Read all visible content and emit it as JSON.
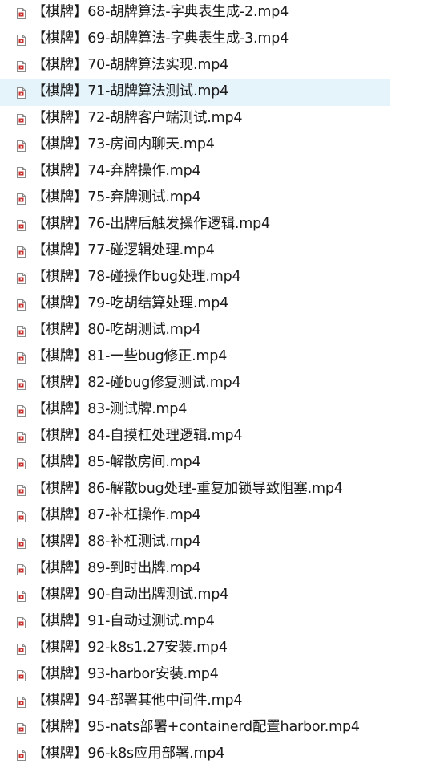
{
  "files": [
    {
      "name": "【棋牌】68-胡牌算法-字典表生成-2.mp4",
      "icon": "video-file-icon"
    },
    {
      "name": "【棋牌】69-胡牌算法-字典表生成-3.mp4",
      "icon": "video-file-icon"
    },
    {
      "name": "【棋牌】70-胡牌算法实现.mp4",
      "icon": "video-file-icon"
    },
    {
      "name": "【棋牌】71-胡牌算法测试.mp4",
      "icon": "video-file-icon",
      "hovered": true
    },
    {
      "name": "【棋牌】72-胡牌客户端测试.mp4",
      "icon": "video-file-icon"
    },
    {
      "name": "【棋牌】73-房间内聊天.mp4",
      "icon": "video-file-icon"
    },
    {
      "name": "【棋牌】74-弃牌操作.mp4",
      "icon": "video-file-icon"
    },
    {
      "name": "【棋牌】75-弃牌测试.mp4",
      "icon": "video-file-icon"
    },
    {
      "name": "【棋牌】76-出牌后触发操作逻辑.mp4",
      "icon": "video-file-icon"
    },
    {
      "name": "【棋牌】77-碰逻辑处理.mp4",
      "icon": "video-file-icon"
    },
    {
      "name": "【棋牌】78-碰操作bug处理.mp4",
      "icon": "video-file-icon"
    },
    {
      "name": "【棋牌】79-吃胡结算处理.mp4",
      "icon": "video-file-icon"
    },
    {
      "name": "【棋牌】80-吃胡测试.mp4",
      "icon": "video-file-icon"
    },
    {
      "name": "【棋牌】81-一些bug修正.mp4",
      "icon": "video-file-icon"
    },
    {
      "name": "【棋牌】82-碰bug修复测试.mp4",
      "icon": "video-file-icon"
    },
    {
      "name": "【棋牌】83-测试牌.mp4",
      "icon": "video-file-icon"
    },
    {
      "name": "【棋牌】84-自摸杠处理逻辑.mp4",
      "icon": "video-file-icon"
    },
    {
      "name": "【棋牌】85-解散房间.mp4",
      "icon": "video-file-icon"
    },
    {
      "name": "【棋牌】86-解散bug处理-重复加锁导致阻塞.mp4",
      "icon": "video-file-icon"
    },
    {
      "name": "【棋牌】87-补杠操作.mp4",
      "icon": "video-file-icon"
    },
    {
      "name": "【棋牌】88-补杠测试.mp4",
      "icon": "video-file-icon"
    },
    {
      "name": "【棋牌】89-到时出牌.mp4",
      "icon": "video-file-icon"
    },
    {
      "name": "【棋牌】90-自动出牌测试.mp4",
      "icon": "video-file-icon"
    },
    {
      "name": "【棋牌】91-自动过测试.mp4",
      "icon": "video-file-icon"
    },
    {
      "name": "【棋牌】92-k8s1.27安装.mp4",
      "icon": "video-file-icon"
    },
    {
      "name": "【棋牌】93-harbor安装.mp4",
      "icon": "video-file-icon"
    },
    {
      "name": "【棋牌】94-部署其他中间件.mp4",
      "icon": "video-file-icon"
    },
    {
      "name": "【棋牌】95-nats部署+containerd配置harbor.mp4",
      "icon": "video-file-icon"
    },
    {
      "name": "【棋牌】96-k8s应用部署.mp4",
      "icon": "video-file-icon"
    }
  ],
  "colors": {
    "hover_row": "#e5f3fb",
    "text": "#1b1b1b",
    "icon_red": "#c8302e",
    "icon_border": "#8a8a8a"
  }
}
